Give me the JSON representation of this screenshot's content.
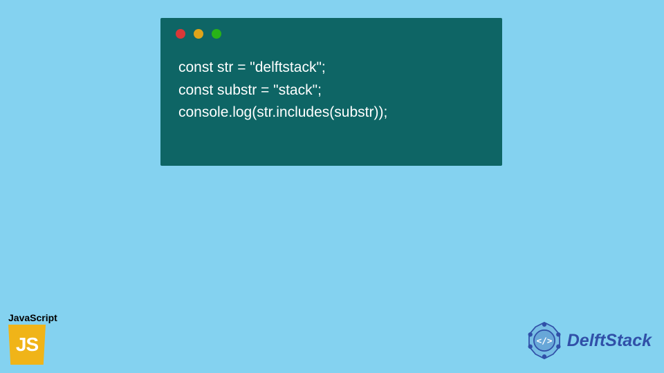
{
  "code": {
    "lines": [
      "const str = \"delftstack\";",
      "const substr = \"stack\";",
      "console.log(str.includes(substr));"
    ]
  },
  "js_badge": {
    "label": "JavaScript",
    "logo_text": "JS"
  },
  "brand": {
    "name": "DelftStack"
  },
  "colors": {
    "background": "#84d2f0",
    "window": "#0e6565",
    "dot_red": "#d93838",
    "dot_yellow": "#dfa41a",
    "dot_green": "#28b318",
    "js_gold": "#f0b418",
    "brand_blue": "#3050a8"
  }
}
